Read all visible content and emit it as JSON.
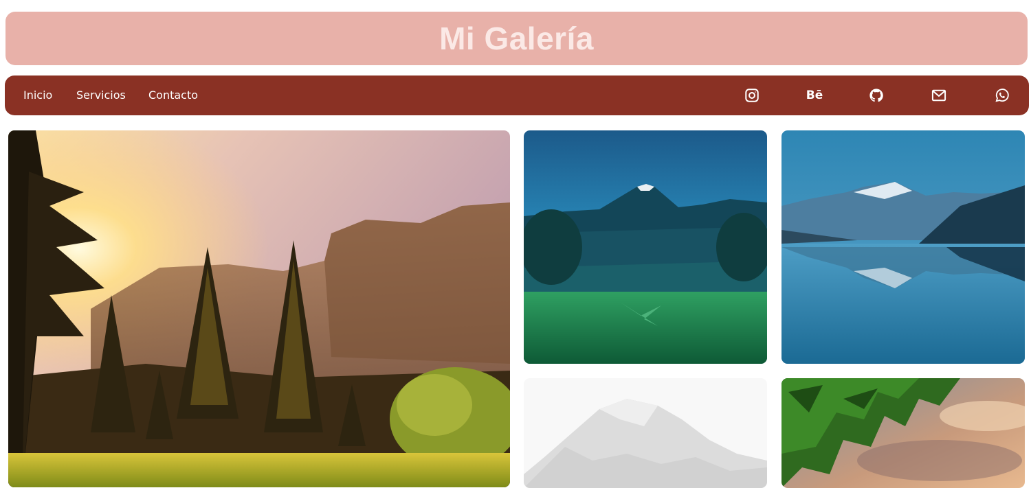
{
  "header": {
    "title": "Mi Galería"
  },
  "nav": {
    "links": [
      "Inicio",
      "Servicios",
      "Contacto"
    ],
    "social": [
      {
        "icon": "instagram-icon"
      },
      {
        "icon": "behance-icon",
        "text": "Bē"
      },
      {
        "icon": "github-icon"
      },
      {
        "icon": "mail-icon"
      },
      {
        "icon": "whatsapp-icon"
      }
    ]
  },
  "colors": {
    "banner": "#e8b1a9",
    "banner_text": "#fbe9e6",
    "navbar": "#8a3124",
    "nav_text": "#ffffff"
  },
  "gallery": {
    "images": [
      {
        "name": "sunset-forest-mountain-photo"
      },
      {
        "name": "night-volcano-valley-photo"
      },
      {
        "name": "mountain-lake-reflection-photo"
      },
      {
        "name": "snowy-mountain-photo"
      },
      {
        "name": "tree-sunset-sky-photo"
      }
    ]
  }
}
